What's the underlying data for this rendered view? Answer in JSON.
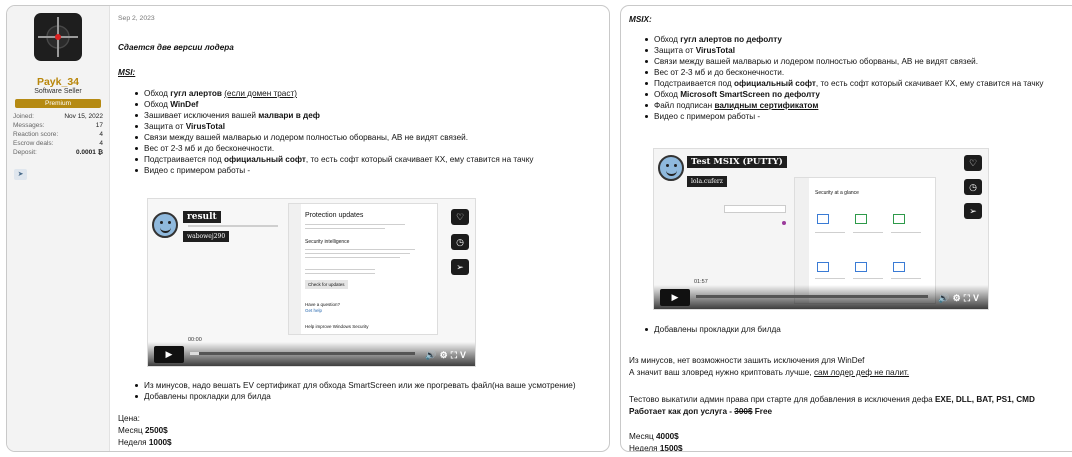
{
  "user": {
    "name": "Payk_34",
    "title": "Software Seller",
    "badge": "Premium",
    "stats": [
      {
        "label": "Joined:",
        "value": "Nov 15, 2022"
      },
      {
        "label": "Messages:",
        "value": "17"
      },
      {
        "label": "Reaction score:",
        "value": "4"
      },
      {
        "label": "Escrow deals:",
        "value": "4"
      },
      {
        "label": "Deposit:",
        "value": "0.0001 ₿"
      }
    ],
    "telegram_icon": "telegram-icon"
  },
  "post": {
    "date": "Sep 2, 2023",
    "intro": "Сдается две версии лодера",
    "msi_heading": "MSI:",
    "msi_items": [
      {
        "pre": "Обход ",
        "bold": "гугл алертов",
        "post": " ",
        "link": "(если домен траст)"
      },
      {
        "pre": "Обход ",
        "bold": "WinDef",
        "post": ""
      },
      {
        "pre": "Зашивает исключения вашей ",
        "bold": "малвари в деф",
        "post": ""
      },
      {
        "pre": "Защита от ",
        "bold": "VirusTotal",
        "post": ""
      },
      {
        "pre": "Связи между вашей малварью и лодером полностью оборваны, АВ не видят связей.",
        "bold": "",
        "post": ""
      },
      {
        "pre": "Вес от 2-3 мб и до бесконечности.",
        "bold": "",
        "post": ""
      },
      {
        "pre": "Подстраивается под ",
        "bold": "официальный софт",
        "post": ", то есть софт который скачивает КХ, ему ставится на тачку"
      },
      {
        "pre": "Видео с примером работы -",
        "bold": "",
        "post": ""
      }
    ],
    "msi_video": {
      "title": "result",
      "subtitle": "wabowej290",
      "protection_title": "Protection updates",
      "security_label": "Security intelligence",
      "check_button": "Check for updates",
      "question": "Have a question?",
      "help": "Get help",
      "improve": "Help improve Windows Security",
      "time": "00:00",
      "side_icons": [
        "heart-icon",
        "clock-icon",
        "send-icon"
      ]
    },
    "msi_after": [
      "Из минусов, надо вешать EV сертификат для обхода SmartScreen или же прогревать файл(на ваше усмотрение)",
      "Добавлены прокладки для билда"
    ],
    "price_label": "Цена:",
    "month_label": "Месяц ",
    "month_price": "2500$",
    "week_label": "Неделя ",
    "week_price": "1000$"
  },
  "msix": {
    "heading": "MSIX:",
    "items": [
      {
        "pre": "Обход ",
        "bold": "гугл алертов по дефолту",
        "post": ""
      },
      {
        "pre": "Защита от ",
        "bold": "VirusTotal",
        "post": ""
      },
      {
        "pre": "Связи между вашей малварью и лодером полностью оборваны, АВ не видят связей.",
        "bold": "",
        "post": ""
      },
      {
        "pre": "Вес от 2-3 мб и до бесконечности.",
        "bold": "",
        "post": ""
      },
      {
        "pre": "Подстраивается под ",
        "bold": "официальный софт",
        "post": ", то есть софт который скачивает КХ, ему ставится на тачку"
      },
      {
        "pre": "Обход ",
        "bold": "Microsoft SmartScreen по дефолту",
        "post": ""
      },
      {
        "pre": "Файл подписан ",
        "bold": "валидным сертификатом",
        "post": ""
      },
      {
        "pre": "Видео с примером работы -",
        "bold": "",
        "post": ""
      }
    ],
    "video": {
      "title": "Test MSIX (PUTTY)",
      "subtitle": "lola.cuferz",
      "security_title": "Security at a glance",
      "time": "01:57"
    },
    "after": "Добавлены прокладки для билда",
    "minus1": "Из минусов, нет возможности зашить исключения для WinDef",
    "minus2_pre": "А значит ваш зловред нужно криптовать лучше, ",
    "minus2_link": "сам лодер деф не палит.",
    "test1": "Тестово выкатили админ права при старте для добавления в исключения дефа ",
    "test1_bold": "EXE, DLL, BAT, PS1, CMD",
    "test2_bold": "Работает как доп услуга - ",
    "test2_strike": "300$",
    "test2_free": " Free",
    "month_label": "Месяц ",
    "month_price": "4000$",
    "week_label": "Неделя ",
    "week_price": "1500$"
  }
}
